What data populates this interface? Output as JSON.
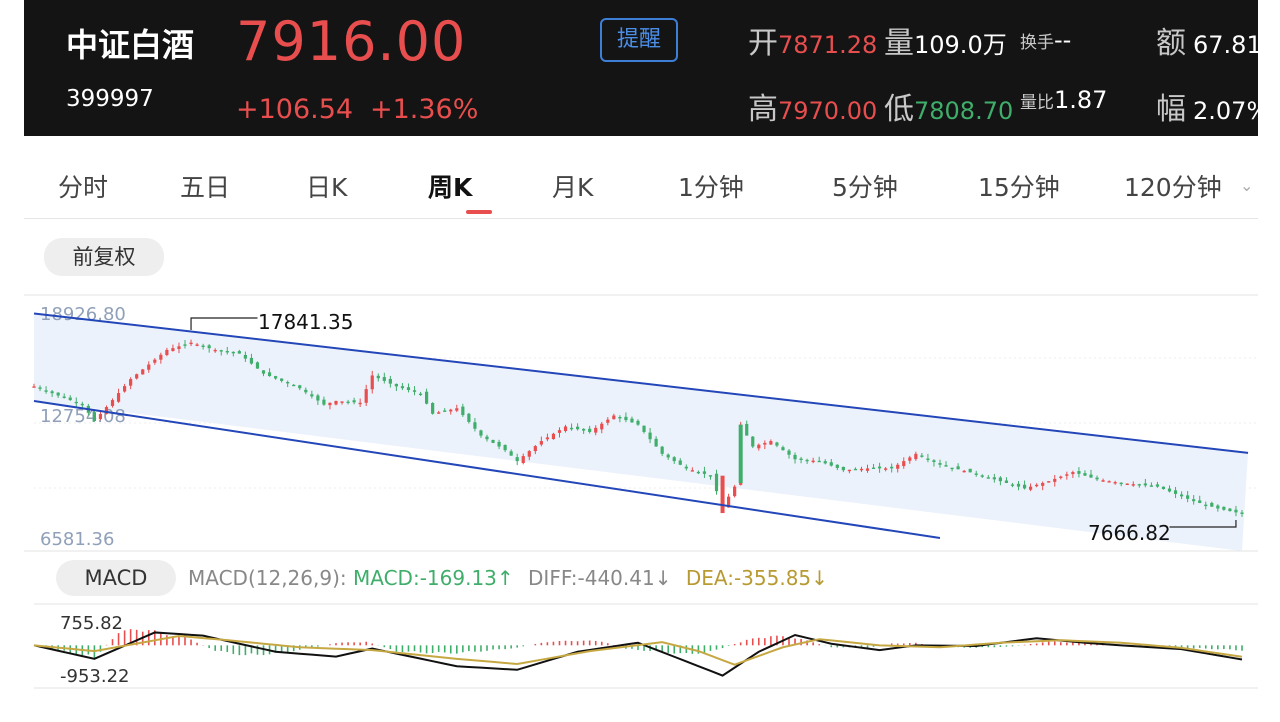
{
  "quote": {
    "name": "中证白酒",
    "code": "399997",
    "price": "7916.00",
    "change": "+106.54",
    "change_pct": "+1.36%",
    "remind_label": "提醒",
    "open_label": "开",
    "open": "7871.28",
    "volume_label": "量",
    "volume": "109.0万",
    "turnover_label": "换手",
    "turnover": "--",
    "amount_label": "额",
    "amount": "67.81",
    "high_label": "高",
    "high": "7970.00",
    "low_label": "低",
    "low": "7808.70",
    "vol_ratio_label": "量比",
    "vol_ratio": "1.87",
    "amplitude_label": "幅",
    "amplitude": "2.07%"
  },
  "tabs": [
    "分时",
    "五日",
    "日K",
    "周K",
    "月K",
    "1分钟",
    "5分钟",
    "15分钟",
    "120分钟"
  ],
  "active_tab": "周K",
  "adjust_label": "前复权",
  "indicator": {
    "name": "MACD",
    "params": "MACD(12,26,9):",
    "macd": "MACD:-169.13",
    "diff": "DIFF:-440.41",
    "dea": "DEA:-355.85",
    "macd_arrow": "↑",
    "diff_arrow": "↓",
    "dea_arrow": "↓"
  },
  "colors": {
    "up": "#e84e4e",
    "down": "#3fae6a",
    "accent": "#3d7fd6",
    "channel": "#2346b8",
    "dea": "#c6a843"
  },
  "chart_data": [
    {
      "type": "candlestick",
      "yaxis_labels": [
        "18926.80",
        "12754.08",
        "6581.36"
      ],
      "ylim": [
        6581.36,
        18926.8
      ],
      "grid": true,
      "annotations": [
        {
          "label": "17841.35",
          "note": "max high"
        },
        {
          "label": "7666.82",
          "note": "min low"
        }
      ],
      "channel": {
        "upper": [
          [
            0,
            18900
          ],
          [
            201,
            11250
          ]
        ],
        "lower": [
          [
            0,
            14100
          ],
          [
            150,
            6581.36
          ]
        ]
      },
      "close_path": [
        [
          0,
          14900
        ],
        [
          8,
          13900
        ],
        [
          10,
          13000
        ],
        [
          16,
          15300
        ],
        [
          22,
          16900
        ],
        [
          26,
          17300
        ],
        [
          30,
          16900
        ],
        [
          34,
          16700
        ],
        [
          38,
          15600
        ],
        [
          44,
          14800
        ],
        [
          48,
          13900
        ],
        [
          50,
          14100
        ],
        [
          54,
          14000
        ],
        [
          56,
          15500
        ],
        [
          60,
          14900
        ],
        [
          64,
          14500
        ],
        [
          66,
          13400
        ],
        [
          70,
          13700
        ],
        [
          74,
          12200
        ],
        [
          78,
          11400
        ],
        [
          80,
          10800
        ],
        [
          84,
          11900
        ],
        [
          88,
          12700
        ],
        [
          92,
          12400
        ],
        [
          96,
          13300
        ],
        [
          100,
          12800
        ],
        [
          104,
          11200
        ],
        [
          108,
          10400
        ],
        [
          112,
          10000
        ],
        [
          114,
          8300
        ],
        [
          116,
          9400
        ],
        [
          117,
          12800
        ],
        [
          119,
          11600
        ],
        [
          122,
          11900
        ],
        [
          126,
          10900
        ],
        [
          130,
          10800
        ],
        [
          134,
          10300
        ],
        [
          138,
          10400
        ],
        [
          142,
          10400
        ],
        [
          146,
          11200
        ],
        [
          150,
          10600
        ],
        [
          156,
          10100
        ],
        [
          160,
          9700
        ],
        [
          164,
          9300
        ],
        [
          168,
          9700
        ],
        [
          172,
          10200
        ],
        [
          176,
          9800
        ],
        [
          180,
          9600
        ],
        [
          186,
          9400
        ],
        [
          192,
          8600
        ],
        [
          196,
          8200
        ],
        [
          200,
          7916
        ]
      ]
    },
    {
      "type": "bar",
      "name": "MACD",
      "yaxis_labels": [
        "755.82",
        "-953.22"
      ],
      "ylim": [
        -953.22,
        755.82
      ],
      "series": [
        {
          "name": "DIFF",
          "path": [
            [
              0,
              0
            ],
            [
              10,
              -420
            ],
            [
              20,
              400
            ],
            [
              28,
              300
            ],
            [
              40,
              -200
            ],
            [
              50,
              -350
            ],
            [
              56,
              -100
            ],
            [
              70,
              -650
            ],
            [
              80,
              -760
            ],
            [
              90,
              -200
            ],
            [
              100,
              80
            ],
            [
              108,
              -500
            ],
            [
              114,
              -940
            ],
            [
              120,
              -200
            ],
            [
              126,
              320
            ],
            [
              132,
              50
            ],
            [
              140,
              -150
            ],
            [
              146,
              0
            ],
            [
              156,
              -20
            ],
            [
              166,
              220
            ],
            [
              174,
              80
            ],
            [
              180,
              0
            ],
            [
              190,
              -120
            ],
            [
              200,
              -440.41
            ]
          ]
        },
        {
          "name": "DEA",
          "path": [
            [
              0,
              0
            ],
            [
              10,
              -180
            ],
            [
              24,
              290
            ],
            [
              32,
              160
            ],
            [
              44,
              -60
            ],
            [
              56,
              -150
            ],
            [
              70,
              -420
            ],
            [
              80,
              -580
            ],
            [
              92,
              -180
            ],
            [
              104,
              100
            ],
            [
              110,
              -180
            ],
            [
              116,
              -600
            ],
            [
              124,
              -60
            ],
            [
              130,
              190
            ],
            [
              140,
              0
            ],
            [
              150,
              -60
            ],
            [
              160,
              80
            ],
            [
              170,
              160
            ],
            [
              180,
              80
            ],
            [
              190,
              -80
            ],
            [
              200,
              -355.85
            ]
          ]
        }
      ],
      "bars": [
        [
          0,
          0
        ],
        [
          5,
          -200
        ],
        [
          10,
          -420
        ],
        [
          14,
          450
        ],
        [
          18,
          560
        ],
        [
          22,
          380
        ],
        [
          26,
          200
        ],
        [
          30,
          -180
        ],
        [
          35,
          -340
        ],
        [
          40,
          -280
        ],
        [
          45,
          -120
        ],
        [
          50,
          80
        ],
        [
          55,
          120
        ],
        [
          60,
          -200
        ],
        [
          65,
          -250
        ],
        [
          70,
          -260
        ],
        [
          75,
          -180
        ],
        [
          80,
          -80
        ],
        [
          85,
          120
        ],
        [
          90,
          160
        ],
        [
          94,
          140
        ],
        [
          98,
          -120
        ],
        [
          104,
          -220
        ],
        [
          108,
          -300
        ],
        [
          112,
          -220
        ],
        [
          118,
          180
        ],
        [
          122,
          320
        ],
        [
          126,
          260
        ],
        [
          132,
          -60
        ],
        [
          138,
          -100
        ],
        [
          142,
          60
        ],
        [
          146,
          80
        ],
        [
          150,
          -60
        ],
        [
          156,
          -80
        ],
        [
          162,
          -40
        ],
        [
          168,
          130
        ],
        [
          172,
          100
        ],
        [
          176,
          40
        ],
        [
          182,
          -50
        ],
        [
          188,
          -90
        ],
        [
          194,
          -110
        ],
        [
          200,
          -169.13
        ]
      ]
    }
  ]
}
